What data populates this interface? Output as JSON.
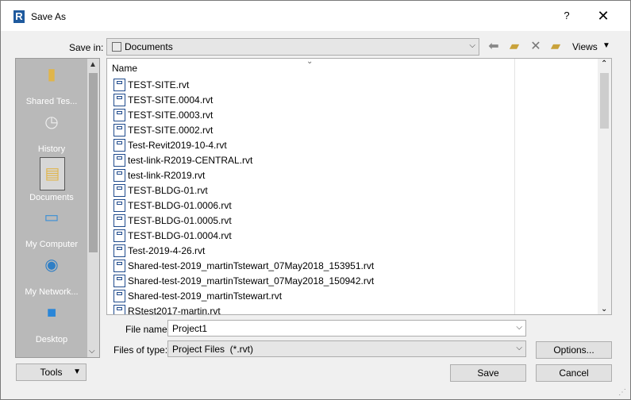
{
  "window": {
    "title": "Save As",
    "help_label": "?",
    "close_label": "✕",
    "app_icon_letter": "R"
  },
  "save_in": {
    "label": "Save in:",
    "value": "Documents"
  },
  "toolbar": {
    "views_label": "Views",
    "icons": [
      "back-arrow-icon",
      "up-folder-icon",
      "delete-icon",
      "new-folder-icon"
    ]
  },
  "places": [
    {
      "label": "Shared Tes...",
      "icon": "shared-folder-icon"
    },
    {
      "label": "History",
      "icon": "history-icon"
    },
    {
      "label": "Documents",
      "icon": "documents-icon",
      "selected": true
    },
    {
      "label": "My Computer",
      "icon": "computer-icon"
    },
    {
      "label": "My Network...",
      "icon": "network-icon"
    },
    {
      "label": "Desktop",
      "icon": "desktop-icon"
    }
  ],
  "file_list": {
    "column_header": "Name",
    "files": [
      "TEST-SITE.rvt",
      "TEST-SITE.0004.rvt",
      "TEST-SITE.0003.rvt",
      "TEST-SITE.0002.rvt",
      "Test-Revit2019-10-4.rvt",
      "test-link-R2019-CENTRAL.rvt",
      "test-link-R2019.rvt",
      "TEST-BLDG-01.rvt",
      "TEST-BLDG-01.0006.rvt",
      "TEST-BLDG-01.0005.rvt",
      "TEST-BLDG-01.0004.rvt",
      "Test-2019-4-26.rvt",
      "Shared-test-2019_martinTstewart_07May2018_153951.rvt",
      "Shared-test-2019_martinTstewart_07May2018_150942.rvt",
      "Shared-test-2019_martinTstewart.rvt",
      "RStest2017-martin.rvt"
    ]
  },
  "file_name": {
    "label": "File name:",
    "value": "Project1"
  },
  "file_type": {
    "label": "Files of type:",
    "value": "Project Files  (*.rvt)"
  },
  "buttons": {
    "options": "Options...",
    "tools": "Tools",
    "save": "Save",
    "cancel": "Cancel"
  },
  "colors": {
    "places_bg": "#b9b9b9",
    "rvt_icon": "#1f4a8c",
    "app_icon": "#1f5a9e"
  }
}
